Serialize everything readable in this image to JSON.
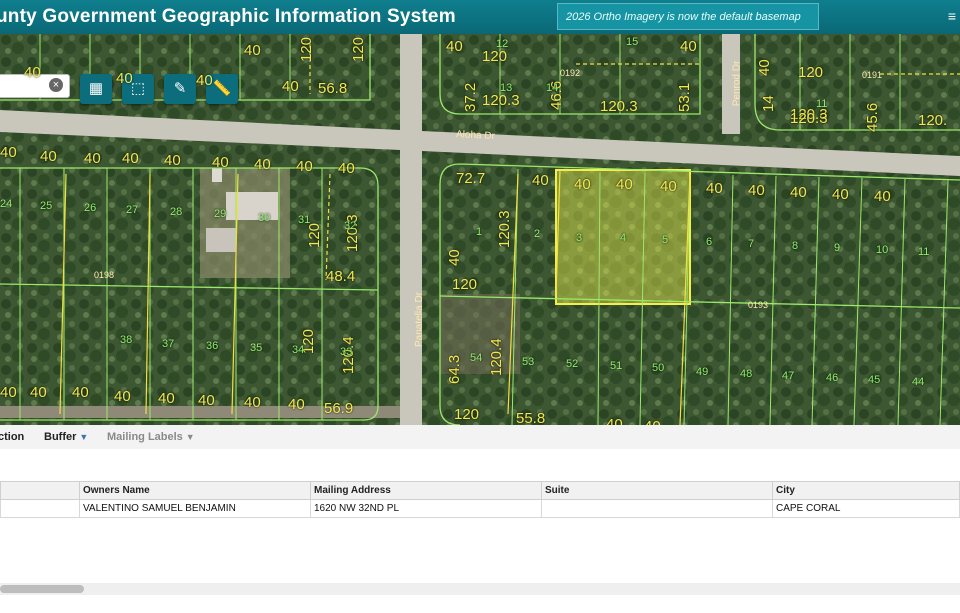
{
  "header": {
    "title": "unty Government Geographic Information System",
    "notice": "2026 Ortho Imagery is now the default basemap",
    "menu_icon": "hamburger-icon"
  },
  "map": {
    "search_placeholder": "",
    "toolbar": [
      {
        "icon": "grid-layers-icon"
      },
      {
        "icon": "select-rectangle-icon"
      },
      {
        "icon": "edit-notes-icon"
      },
      {
        "icon": "measure-ruler-icon"
      }
    ],
    "streets": [
      "Aloha Dr",
      "Panatella Dr",
      "Penrod Dr"
    ],
    "block_labels": [
      "0192",
      "0191",
      "0198",
      "0193"
    ],
    "dimension_labels_top_left": [
      "40",
      "40",
      "40",
      "40",
      "56.8",
      "120",
      "120",
      "40"
    ],
    "dimension_labels_mid_left": [
      "40",
      "40",
      "40",
      "40",
      "40",
      "40",
      "40",
      "40",
      "40",
      "40",
      "120",
      "120.3",
      "48.4",
      "120",
      "120.4",
      "40",
      "40",
      "40",
      "40",
      "40",
      "40",
      "40",
      "40",
      "40",
      "56.9"
    ],
    "dimension_labels_center": [
      "40",
      "120",
      "37.2",
      "120.3",
      "46.6",
      "120.3",
      "53.1",
      "40"
    ],
    "dimension_labels_right_top": [
      "40",
      "120",
      "40",
      "120.3",
      "14",
      "120.3",
      "45.6",
      "120."
    ],
    "dimension_labels_mid_right": [
      "72.7",
      "40",
      "40",
      "40",
      "40",
      "40",
      "40",
      "40",
      "40",
      "40",
      "40",
      "40",
      "120.3",
      "120",
      "64.3",
      "120.4",
      "120",
      "55.8",
      "40",
      "40",
      "40"
    ],
    "lot_numbers_left": [
      "24",
      "25",
      "26",
      "27",
      "28",
      "29",
      "30",
      "31",
      "32",
      "38",
      "37",
      "36",
      "35",
      "34",
      "33"
    ],
    "lot_numbers_center": [
      "12",
      "15",
      "13",
      "14",
      "11"
    ],
    "lot_numbers_right": [
      "1",
      "2",
      "3",
      "4",
      "5",
      "6",
      "7",
      "8",
      "9",
      "10",
      "11",
      "54",
      "53",
      "52",
      "51",
      "50",
      "49",
      "48",
      "47",
      "46",
      "45",
      "44"
    ],
    "highlight_color": "#eaf04a",
    "line_color_lots": "#9be86a",
    "line_color_dims": "#f2e040"
  },
  "panel": {
    "tabs": [
      {
        "label": "ction",
        "caret": false
      },
      {
        "label": "Buffer",
        "caret": true
      },
      {
        "label": "Mailing Labels",
        "caret": true
      }
    ],
    "columns": [
      "",
      "Owners Name",
      "Mailing Address",
      "Suite",
      "City"
    ],
    "rows": [
      [
        "",
        "VALENTINO SAMUEL BENJAMIN",
        "1620 NW 32ND PL",
        "",
        "CAPE CORAL"
      ]
    ]
  }
}
